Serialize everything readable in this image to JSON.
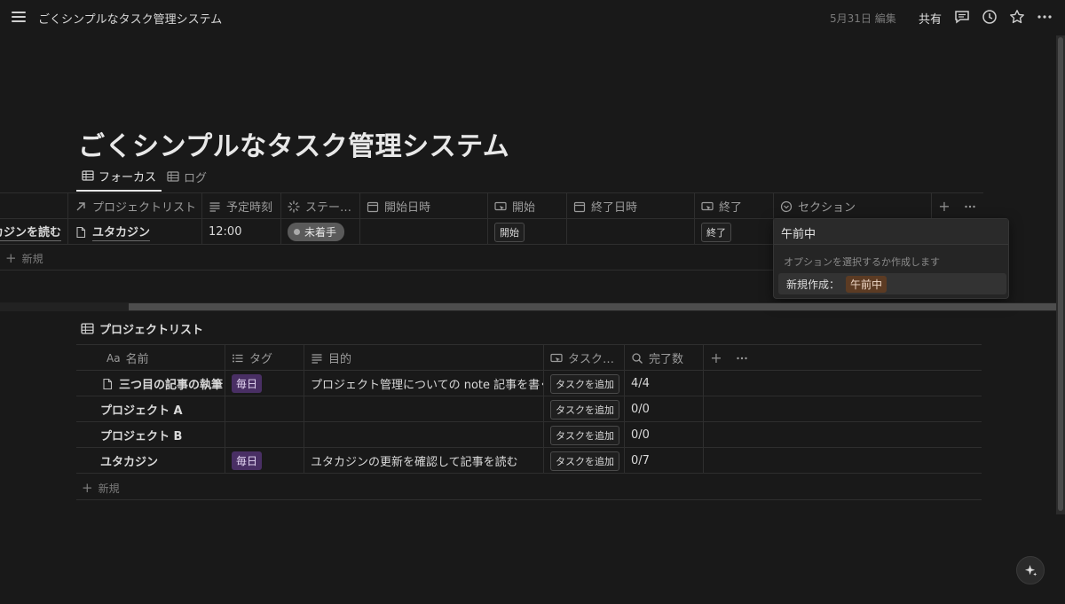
{
  "topbar": {
    "breadcrumb": "ごくシンプルなタスク管理システム",
    "edited": "5月31日 編集",
    "share": "共有"
  },
  "page": {
    "title": "ごくシンプルなタスク管理システム",
    "tabs": [
      {
        "label": "フォーカス",
        "icon": "table-icon",
        "active": true
      },
      {
        "label": "ログ",
        "icon": "table-icon",
        "active": false
      }
    ]
  },
  "focus_table": {
    "columns": [
      {
        "label": "",
        "icon": ""
      },
      {
        "label": "プロジェクトリスト",
        "icon": "relation-arrow-icon"
      },
      {
        "label": "予定時刻",
        "icon": "text-lines-icon"
      },
      {
        "label": "ステー…",
        "icon": "status-spinner-icon"
      },
      {
        "label": "開始日時",
        "icon": "calendar-icon"
      },
      {
        "label": "開始",
        "icon": "button-cursor-icon"
      },
      {
        "label": "終了日時",
        "icon": "calendar-icon"
      },
      {
        "label": "終了",
        "icon": "button-cursor-icon"
      },
      {
        "label": "セクション",
        "icon": "select-chevron-icon"
      }
    ],
    "row": {
      "name": "カジンを読む",
      "project": "ユタカジン",
      "time": "12:00",
      "status": "未着手",
      "start_button": "開始",
      "end_button": "終了"
    },
    "new_label": "新規"
  },
  "section_dropdown": {
    "input_value": "午前中",
    "hint": "オプションを選択するか作成します",
    "create_label": "新規作成：",
    "create_value": "午前中"
  },
  "project_list": {
    "title": "プロジェクトリスト",
    "columns": [
      {
        "label": "名前",
        "prefix": "Aa"
      },
      {
        "label": "タグ",
        "icon": "list-icon"
      },
      {
        "label": "目的",
        "icon": "text-lines-icon"
      },
      {
        "label": "タスク…",
        "icon": "button-cursor-icon"
      },
      {
        "label": "完了数",
        "icon": "search-icon"
      }
    ],
    "rows": [
      {
        "name": "三つ目の記事の執筆",
        "tag": "毎日",
        "purpose": "プロジェクト管理についての note 記事を書く",
        "button": "タスクを追加",
        "done": "4/4",
        "has_page_icon": true
      },
      {
        "name": "プロジェクト A",
        "tag": "",
        "purpose": "",
        "button": "タスクを追加",
        "done": "0/0",
        "has_page_icon": false
      },
      {
        "name": "プロジェクト B",
        "tag": "",
        "purpose": "",
        "button": "タスクを追加",
        "done": "0/0",
        "has_page_icon": false
      },
      {
        "name": "ユタカジン",
        "tag": "毎日",
        "purpose": "ユタカジンの更新を確認して記事を読む",
        "button": "タスクを追加",
        "done": "0/7",
        "has_page_icon": false
      }
    ],
    "new_label": "新規"
  },
  "colors": {
    "background": "#191919",
    "tag_purple": "#492f64",
    "tag_brown": "#5c3b23",
    "status_gray": "#5a5a5a"
  }
}
